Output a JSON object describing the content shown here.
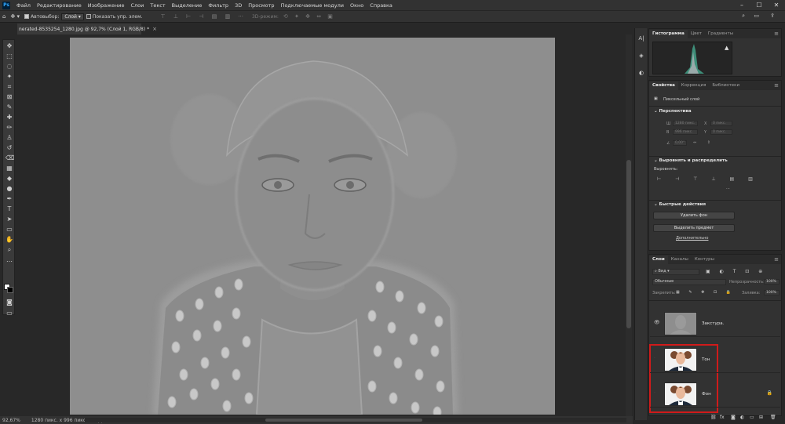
{
  "app": {
    "logo": "Ps"
  },
  "menu": [
    "Файл",
    "Редактирование",
    "Изображение",
    "Слои",
    "Текст",
    "Выделение",
    "Фильтр",
    "3D",
    "Просмотр",
    "Подключаемые модули",
    "Окно",
    "Справка"
  ],
  "window_controls": {
    "minimize": "–",
    "maximize": "☐",
    "close": "✕"
  },
  "options_bar": {
    "autoselect_label": "Автовыбор:",
    "autoselect_checked": true,
    "autoselect_value": "Слой",
    "show_transform_label": "Показать упр. элем.",
    "show_transform_checked": false,
    "mode_3d_label": "3D-режим:"
  },
  "document_tab": {
    "title": "nerated-8535254_1280.jpg @ 92,7% (Слой 1, RGB/8) *",
    "close": "×"
  },
  "tools": [
    "move-icon",
    "marquee-icon",
    "lasso-icon",
    "magic-wand-icon",
    "crop-icon",
    "frame-icon",
    "eyedropper-icon",
    "healing-icon",
    "brush-icon",
    "stamp-icon",
    "history-brush-icon",
    "eraser-icon",
    "gradient-icon",
    "blur-icon",
    "dodge-icon",
    "pen-icon",
    "type-icon",
    "path-select-icon",
    "rectangle-icon",
    "hand-icon",
    "zoom-icon",
    "more-tools-icon"
  ],
  "tool_glyphs": [
    "✥",
    "⬚",
    "◌",
    "✦",
    "⌗",
    "⊠",
    "✎",
    "✚",
    "✏",
    "♙",
    "↺",
    "⌫",
    "▦",
    "◆",
    "●",
    "✒",
    "T",
    "➤",
    "▭",
    "✋",
    "⌕",
    "…"
  ],
  "status": {
    "zoom": "92,67%",
    "size": "1280 пикс. x 996 пикс. (72 ppi)"
  },
  "histogram_panel": {
    "tabs": [
      "Гистограмма",
      "Цвет",
      "Градиенты"
    ],
    "active": 0,
    "warning": "▲"
  },
  "properties_panel": {
    "tabs": [
      "Свойства",
      "Коррекция",
      "Библиотеки"
    ],
    "active": 0,
    "layer_type": "Пиксельный слой",
    "transform_title": "Перспектива",
    "w_label": "Ш",
    "h_label": "В",
    "x_label": "X",
    "y_label": "Y",
    "w_value": "1280 пикс.",
    "h_value": "996 пикс.",
    "x_value": "0 пикс.",
    "y_value": "0 пикс.",
    "angle_value": "0,00°",
    "align_title": "Выровнять и распределить",
    "align_label": "Выровнять:",
    "quick_title": "Быстрые действия",
    "remove_bg": "Удалить фон",
    "select_subject": "Выделить предмет",
    "more_link": "Дополнительно"
  },
  "layers_panel": {
    "tabs": [
      "Слои",
      "Каналы",
      "Контуры"
    ],
    "active": 0,
    "filter_kind": "Вид",
    "blend_mode": "Обычные",
    "opacity_label": "Непрозрачность:",
    "opacity_value": "100%",
    "lock_label": "Закрепить:",
    "fill_label": "Заливка:",
    "fill_value": "100%",
    "layers": [
      {
        "name": "Закстура.",
        "visible": true,
        "kind": "texture"
      },
      {
        "name": "Тон",
        "visible": false,
        "kind": "photo"
      },
      {
        "name": "Фон",
        "visible": false,
        "kind": "photo",
        "locked": true
      }
    ]
  },
  "colors": {
    "highlight": "#d01b1b",
    "bg": "#282828",
    "panel": "#323232"
  }
}
